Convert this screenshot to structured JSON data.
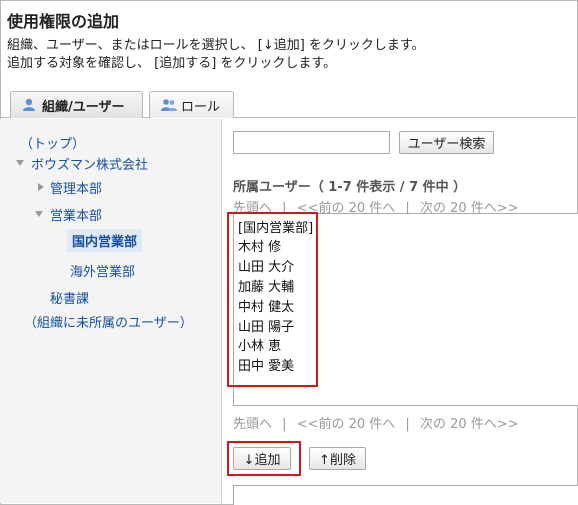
{
  "header": {
    "title": "使用権限の追加",
    "description_line1": "組織、ユーザー、またはロールを選択し、 [↓追加] をクリックします。",
    "description_line2": "追加する対象を確認し、 [追加する] をクリックします。"
  },
  "tabs": {
    "org_user": "組織/ユーザー",
    "role": "ロール"
  },
  "tree": {
    "top": "（トップ）",
    "company": "ボウズマン株式会社",
    "management": "管理本部",
    "sales": "営業本部",
    "domestic_sales": "国内営業部",
    "overseas_sales": "海外営業部",
    "secretary": "秘書課",
    "unaffiliated": "（組織に未所属のユーザー）"
  },
  "search": {
    "input_value": "",
    "button_label": "ユーザー検索"
  },
  "user_list": {
    "heading": "所属ユーザー（ 1-7 件表示 / 7 件中 ）",
    "pager": {
      "first": "先頭へ",
      "separator": "|",
      "prev": "<<前の 20 件へ",
      "next": "次の 20 件へ>>"
    },
    "items": [
      "[国内営業部]",
      "木村 修",
      "山田 大介",
      "加藤 大輔",
      "中村 健太",
      "山田 陽子",
      "小林 恵",
      "田中 愛美"
    ]
  },
  "actions": {
    "add_label": "↓追加",
    "remove_label": "↑削除"
  },
  "colors": {
    "link": "#1750a3",
    "highlight_border": "#d01818",
    "selected_bg": "#dfe9f8"
  }
}
